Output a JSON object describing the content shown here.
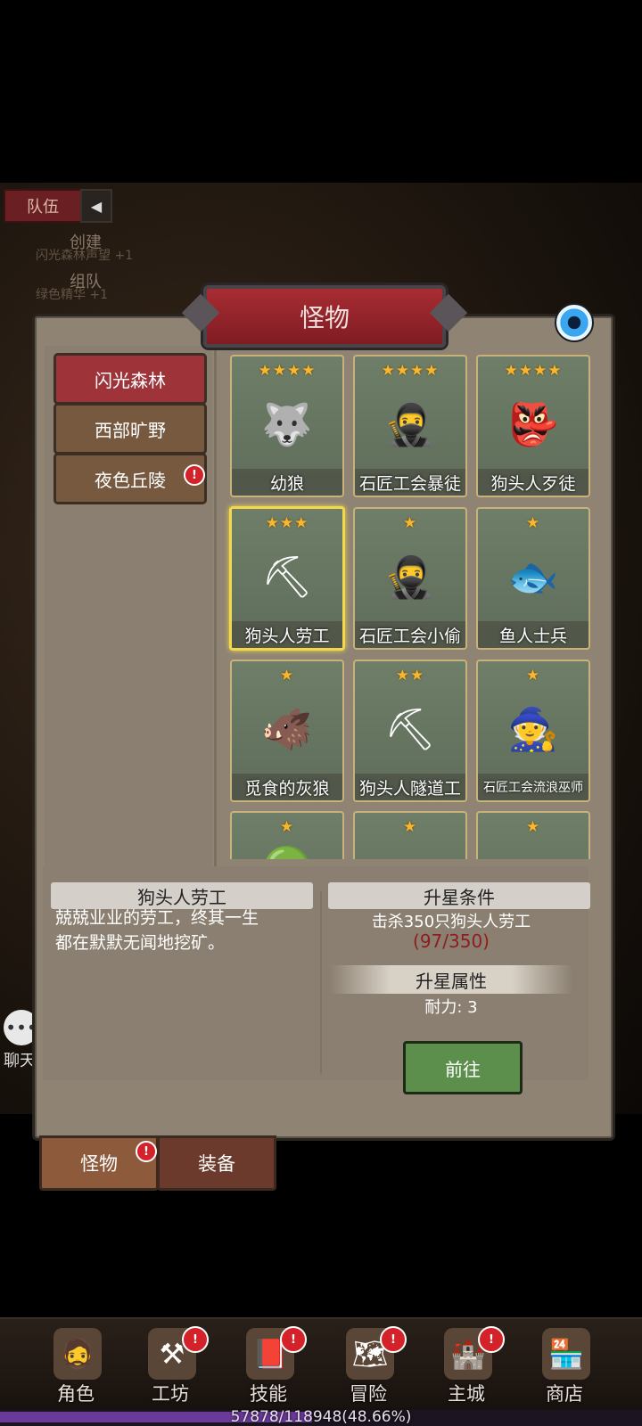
{
  "background": {
    "team_tab": "队伍",
    "create_label": "创建",
    "reputation_text": "闪光森林声望 +1",
    "team_up_label": "组队",
    "essence_text": "绿色精华 +1",
    "chat_label": "聊天"
  },
  "panel": {
    "title": "怪物"
  },
  "regions": [
    {
      "label": "闪光森林",
      "active": true
    },
    {
      "label": "西部旷野",
      "active": false
    },
    {
      "label": "夜色丘陵",
      "active": false,
      "badge": "!"
    }
  ],
  "monsters": [
    {
      "name": "幼狼",
      "stars": "★★★★",
      "icon": "wolf-cub-icon"
    },
    {
      "name": "石匠工会暴徒",
      "stars": "★★★★",
      "icon": "masked-thug-icon"
    },
    {
      "name": "狗头人歹徒",
      "stars": "★★★★",
      "icon": "kobold-bandit-icon"
    },
    {
      "name": "狗头人劳工",
      "stars": "★★★",
      "icon": "kobold-miner-icon",
      "selected": true
    },
    {
      "name": "石匠工会小偷",
      "stars": "★",
      "icon": "masked-thief-icon"
    },
    {
      "name": "鱼人士兵",
      "stars": "★",
      "icon": "murloc-soldier-icon"
    },
    {
      "name": "觅食的灰狼",
      "stars": "★",
      "icon": "gray-wolf-icon"
    },
    {
      "name": "狗头人隧道工",
      "stars": "★★",
      "icon": "kobold-tunneler-icon"
    },
    {
      "name": "石匠工会流浪巫师",
      "stars": "★",
      "icon": "wandering-mage-icon"
    },
    {
      "name": "",
      "stars": "★",
      "icon": "hooded-monster-icon"
    },
    {
      "name": "",
      "stars": "★",
      "icon": "monster-icon"
    },
    {
      "name": "",
      "stars": "★",
      "icon": "monster-icon"
    }
  ],
  "detail": {
    "name": "狗头人劳工",
    "description_line1": "兢兢业业的劳工，终其一生",
    "description_line2": "都在默默无闻地挖矿。",
    "upgrade_title": "升星条件",
    "upgrade_condition": "击杀350只狗头人劳工",
    "progress": "(97/350)",
    "attr_title": "升星属性",
    "attr_value": "耐力: 3",
    "goto_button": "前往"
  },
  "bottom_tabs": [
    {
      "label": "怪物",
      "active": true,
      "badge": "!"
    },
    {
      "label": "装备",
      "active": false
    }
  ],
  "nav": [
    {
      "label": "角色",
      "icon": "character-icon"
    },
    {
      "label": "工坊",
      "icon": "workshop-icon",
      "badge": "!"
    },
    {
      "label": "技能",
      "icon": "skills-icon",
      "badge": "!"
    },
    {
      "label": "冒险",
      "icon": "adventure-icon",
      "badge": "!"
    },
    {
      "label": "主城",
      "icon": "main-city-icon",
      "badge": "!"
    },
    {
      "label": "商店",
      "icon": "shop-icon"
    }
  ],
  "xp": {
    "text": "57878/118948(48.66%)",
    "fraction": 0.4866
  },
  "colors": {
    "region_active": "#9e343a",
    "region_inactive": "#77593f",
    "star": "#f5b82e",
    "progress_red": "#8f1d1d",
    "goto_green": "#5c8e4c",
    "badge_red": "#d3222a"
  }
}
